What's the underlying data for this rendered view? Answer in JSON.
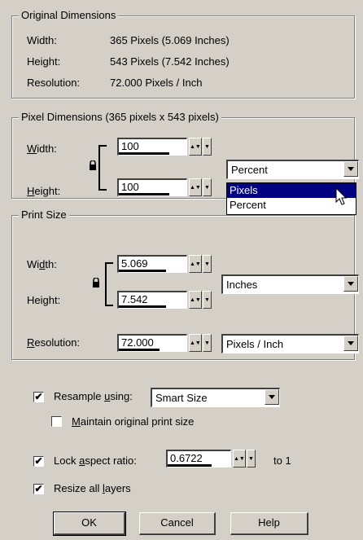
{
  "original": {
    "legend": "Original Dimensions",
    "rows": [
      {
        "label": "Width:",
        "value": "365 Pixels (5.069 Inches)"
      },
      {
        "label": "Height:",
        "value": "543 Pixels (7.542 Inches)"
      },
      {
        "label": "Resolution:",
        "value": "72.000 Pixels / Inch"
      }
    ]
  },
  "pixel": {
    "legend": "Pixel Dimensions (365 pixels x 543 pixels)",
    "width_label": "Width:",
    "height_label": "Height:",
    "width_value": "100",
    "height_value": "100",
    "unit_selected": "Percent",
    "unit_options": [
      "Pixels",
      "Percent"
    ],
    "highlighted_option": "Pixels"
  },
  "print": {
    "legend": "Print Size",
    "width_label": "Width:",
    "height_label": "Height:",
    "resolution_label": "Resolution:",
    "width_value": "5.069",
    "height_value": "7.542",
    "resolution_value": "72.000",
    "size_unit": "Inches",
    "resolution_unit": "Pixels / Inch"
  },
  "options": {
    "resample_label": "Resample using:",
    "resample_checked": true,
    "resample_method": "Smart Size",
    "maintain_label": "Maintain original print size",
    "maintain_checked": false,
    "lock_label": "Lock aspect ratio:",
    "lock_checked": true,
    "ratio_value": "0.6722",
    "ratio_suffix": "to 1",
    "resize_layers_label": "Resize all layers",
    "resize_layers_checked": true
  },
  "buttons": {
    "ok": "OK",
    "cancel": "Cancel",
    "help": "Help"
  }
}
